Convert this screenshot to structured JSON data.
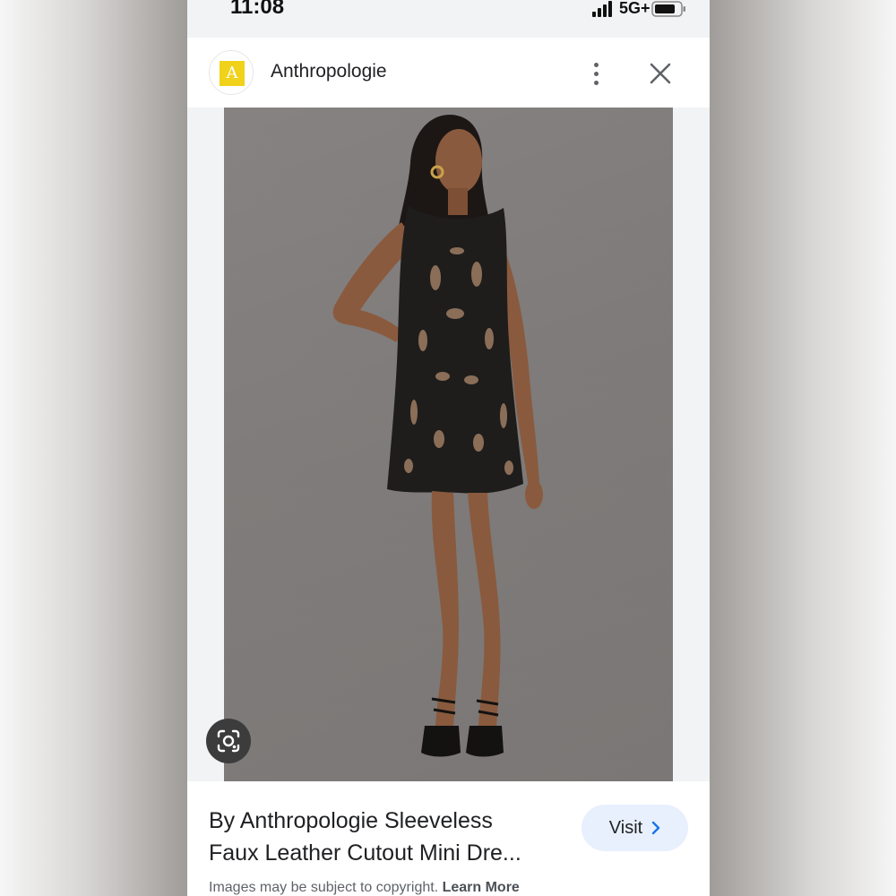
{
  "status_bar": {
    "time": "11:08",
    "network": "5G+",
    "icons": [
      "signal-icon",
      "battery-icon"
    ]
  },
  "header": {
    "favicon_letter": "A",
    "site_name": "Anthropologie",
    "icons": [
      "more-vert-icon",
      "close-icon"
    ]
  },
  "image": {
    "icon": "lens-icon"
  },
  "result": {
    "title_line1": "By Anthropologie Sleeveless",
    "title_line2": "Faux Leather Cutout Mini Dre...",
    "visit_label": "Visit",
    "copyright_text": "Images may be subject to copyright.",
    "learn_more": "Learn More"
  },
  "colors": {
    "favicon_bg": "#f0d21a",
    "visit_bg": "#e8f0fe",
    "visit_chevron": "#1a73e8",
    "image_bg": "#7b7877"
  }
}
